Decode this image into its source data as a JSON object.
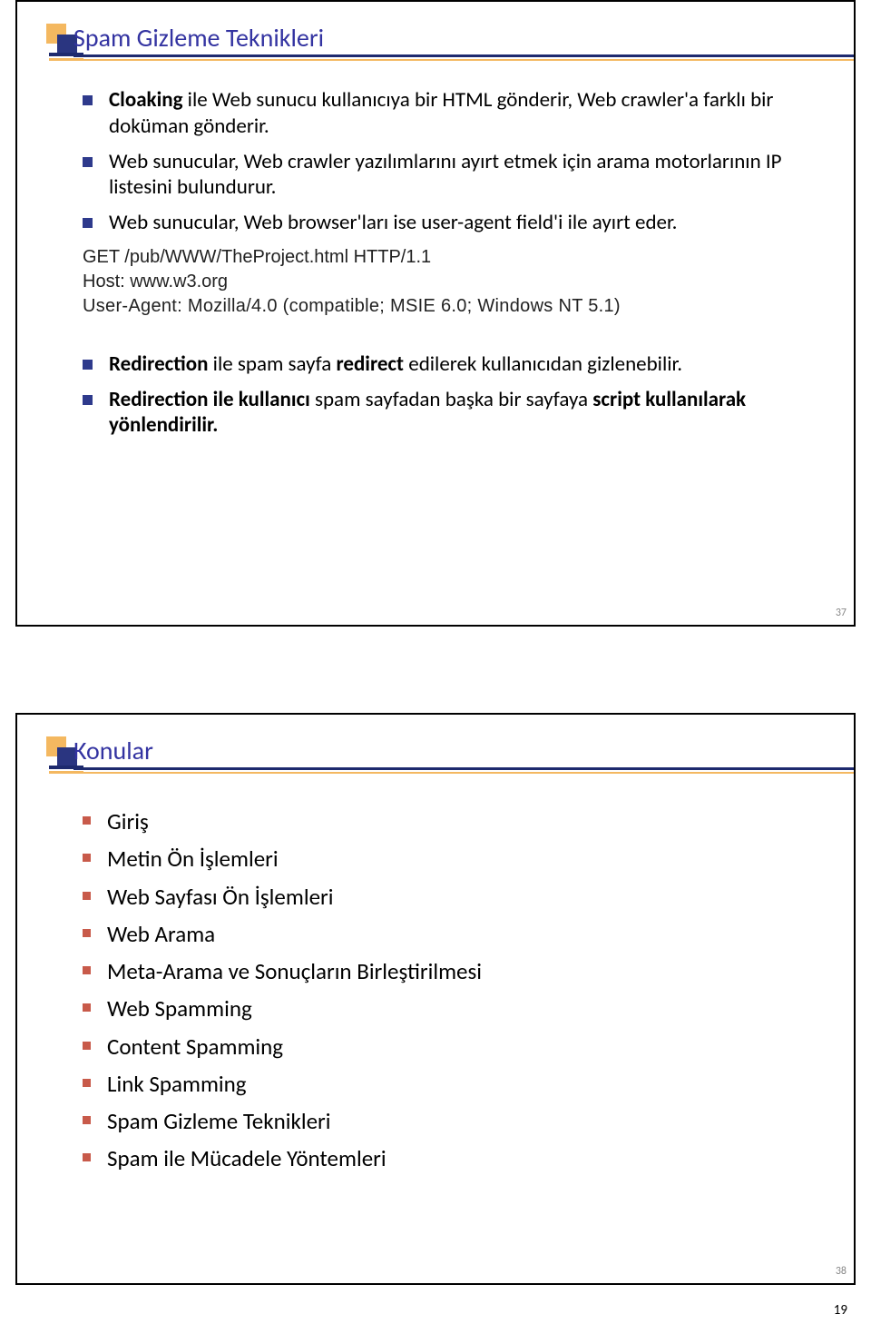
{
  "slide1": {
    "title": "Spam Gizleme Teknikleri",
    "bullets_top": [
      {
        "parts": [
          {
            "t": "Cloaking",
            "b": true
          },
          {
            "t": " ile Web sunucu kullanıcıya bir HTML gönderir, Web crawler'a farklı bir doküman gönderir.",
            "b": false
          }
        ]
      },
      {
        "parts": [
          {
            "t": "Web sunucular, Web crawler yazılımlarını ayırt etmek için arama motorlarının IP listesini bulundurur.",
            "b": false
          }
        ]
      },
      {
        "parts": [
          {
            "t": "Web sunucular, Web browser'ları ise user-agent field'i ile ayırt eder.",
            "b": false
          }
        ]
      }
    ],
    "http": {
      "l1": "GET /pub/WWW/TheProject.html HTTP/1.1",
      "l2": "Host: www.w3.org",
      "l3": "User-Agent: Mozilla/4.0 (compatible; MSIE 6.0; Windows NT 5.1)"
    },
    "bullets_bot": [
      {
        "parts": [
          {
            "t": "Redirection",
            "b": true
          },
          {
            "t": " ile spam sayfa ",
            "b": false
          },
          {
            "t": "redirect",
            "b": true
          },
          {
            "t": " edilerek kullanıcıdan gizlenebilir.",
            "b": false
          }
        ]
      },
      {
        "parts": [
          {
            "t": "Redirection ile kullanıcı ",
            "b": true
          },
          {
            "t": "spam sayfadan başka bir sayfaya ",
            "b": false
          },
          {
            "t": "script kullanılarak yönlendirilir.",
            "b": true
          }
        ]
      }
    ],
    "page": "37"
  },
  "slide2": {
    "title": "Konular",
    "items": [
      "Giriş",
      "Metin Ön İşlemleri",
      "Web Sayfası Ön İşlemleri",
      "Web Arama",
      "Meta-Arama ve Sonuçların Birleştirilmesi",
      "Web Spamming",
      "Content Spamming",
      "Link Spamming",
      "Spam Gizleme Teknikleri",
      "Spam ile Mücadele Yöntemleri"
    ],
    "page": "38"
  },
  "page_overall": "19"
}
